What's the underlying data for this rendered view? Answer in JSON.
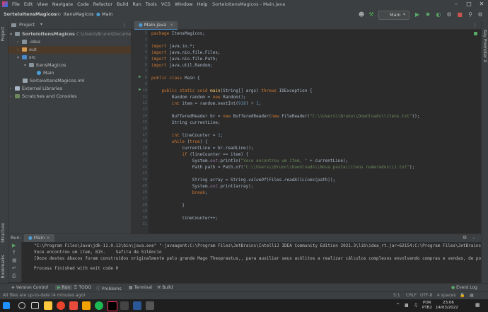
{
  "menu": {
    "items": [
      "File",
      "Edit",
      "View",
      "Navigate",
      "Code",
      "Refactor",
      "Build",
      "Run",
      "Tools",
      "VCS",
      "Window",
      "Help"
    ],
    "window_title": "SorteioItensMagicos - Main.java"
  },
  "nav": {
    "project": "SorteioItensMagicos",
    "src": "src",
    "package": "ItensMagicos",
    "file": "Main",
    "run_config": "Main"
  },
  "left_strip": {
    "project": "Project",
    "structure": "Structure",
    "bookmarks": "Bookmarks"
  },
  "right_strip": {
    "key_promoter": "Key Promoter X"
  },
  "project_panel": {
    "title": "Project",
    "tree": [
      {
        "label": "SorteioItensMagicos",
        "extra": "C:\\Users\\Bruno\\Documents\\Sorte",
        "depth": 0
      },
      {
        "label": ".idea",
        "depth": 1
      },
      {
        "label": "out",
        "depth": 1
      },
      {
        "label": "src",
        "depth": 1
      },
      {
        "label": "ItensMagicos",
        "depth": 2
      },
      {
        "label": "Main",
        "depth": 3
      },
      {
        "label": "SorteioItensMagicos.iml",
        "depth": 1
      },
      {
        "label": "External Libraries",
        "depth": 0
      },
      {
        "label": "Scratches and Consoles",
        "depth": 0
      }
    ]
  },
  "editor": {
    "tab": "Main.java",
    "line_numbers": [
      "1",
      "2",
      "3",
      "4",
      "5",
      "6",
      "7",
      "8",
      "9",
      "10",
      "11",
      "12",
      "13",
      "14",
      "15",
      "16",
      "17",
      "18",
      "19",
      "20",
      "21",
      "22",
      "23",
      "24",
      "25",
      "26",
      "27",
      "28",
      "29",
      "30",
      "31"
    ],
    "code": {
      "l1a": "package",
      "l1b": " ItensMagicos;",
      "l3a": "import",
      "l3b": " java.io.*;",
      "l4a": "import",
      "l4b": " java.nio.file.Files;",
      "l5a": "import",
      "l5b": " java.nio.file.Path;",
      "l6a": "import",
      "l6b": " java.util.Random;",
      "l8a": "public class",
      "l8b": " Main {",
      "l10a": "    public static void",
      "l10b": " main",
      "l10c": "(String[] args) ",
      "l10d": "throws",
      "l10e": " IOException {",
      "l11a": "        Random random = ",
      "l11b": "new",
      "l11c": " Random();",
      "l12a": "        int",
      "l12b": " item = random.nextInt(",
      "l12c": "918",
      "l12d": ") + ",
      "l12e": "1",
      "l12f": ";",
      "l14a": "        BufferedReader br = ",
      "l14b": "new",
      "l14c": " BufferedReader(",
      "l14d": "new",
      "l14e": " FileReader(",
      "l14f": "\"C:\\\\Users\\\\Bruno\\\\Downloads\\\\itens.txt\"",
      "l14g": "));",
      "l15": "        String currentLine;",
      "l17a": "        int",
      "l17b": " lineCounter = ",
      "l17c": "1",
      "l17d": ";",
      "l18a": "        while",
      "l18b": " (",
      "l18c": "true",
      "l18d": ") {",
      "l19": "            currentLine = br.readLine();",
      "l20a": "            if",
      "l20b": " (lineCounter == item) {",
      "l21a": "                System.",
      "l21b": "out",
      "l21c": ".println(",
      "l21d": "\"Voce encontrou um item, \"",
      "l21e": " + currentLine);",
      "l22a": "                Path path = Path.",
      "l22b": "of",
      "l22c": "(",
      "l22d": "\"C:\\\\Users\\\\Bruno\\\\Downloads\\\\Nova pasta\\\\itens numerados\\\\1.txt\"",
      "l22e": ");",
      "l24a": "                String array = String.",
      "l24b": "valueOf",
      "l24c": "(Files.",
      "l24d": "readAllLines",
      "l24e": "(path));",
      "l25a": "                System.",
      "l25b": "out",
      "l25c": ".print(array);",
      "l26a": "                break",
      "l26b": ";",
      "l28": "            }",
      "l29": "            lineCounter++;"
    }
  },
  "run": {
    "label": "Run:",
    "tab": "Main",
    "output": [
      "\"C:\\Program Files\\Java\\jdk-11.0.13\\bin\\java.exe\" \"-javaagent:C:\\Program Files\\JetBrains\\IntelliJ IDEA Community Edition 2021.3\\lib\\idea_rt.jar=62154:C:\\Program Files\\JetBrains\\Intell",
      "Voce encontrou um item, 815.    Safira de Silêncio",
      "[Doze destes ábacos foram construídos originalmente pelo grande Mago Theoprastus,, para auxiliar seus acólitos a realizar cálculos complexos envolvendo compras e vendas, de poções e ",
      "",
      "Process finished with exit code 0"
    ]
  },
  "bottom_tools": [
    "Version Control",
    "Run",
    "TODO",
    "Problems",
    "Terminal",
    "Build"
  ],
  "event_log": "Event Log",
  "status": {
    "message": "All files are up-to-date (4 minutes ago)",
    "position": "5:1",
    "line_sep": "CRLF",
    "encoding": "UTF-8",
    "indent": "4 spaces"
  },
  "taskbar": {
    "lang1": "POR",
    "lang2": "PTB2",
    "time": "23:06",
    "date": "14/03/2022"
  }
}
